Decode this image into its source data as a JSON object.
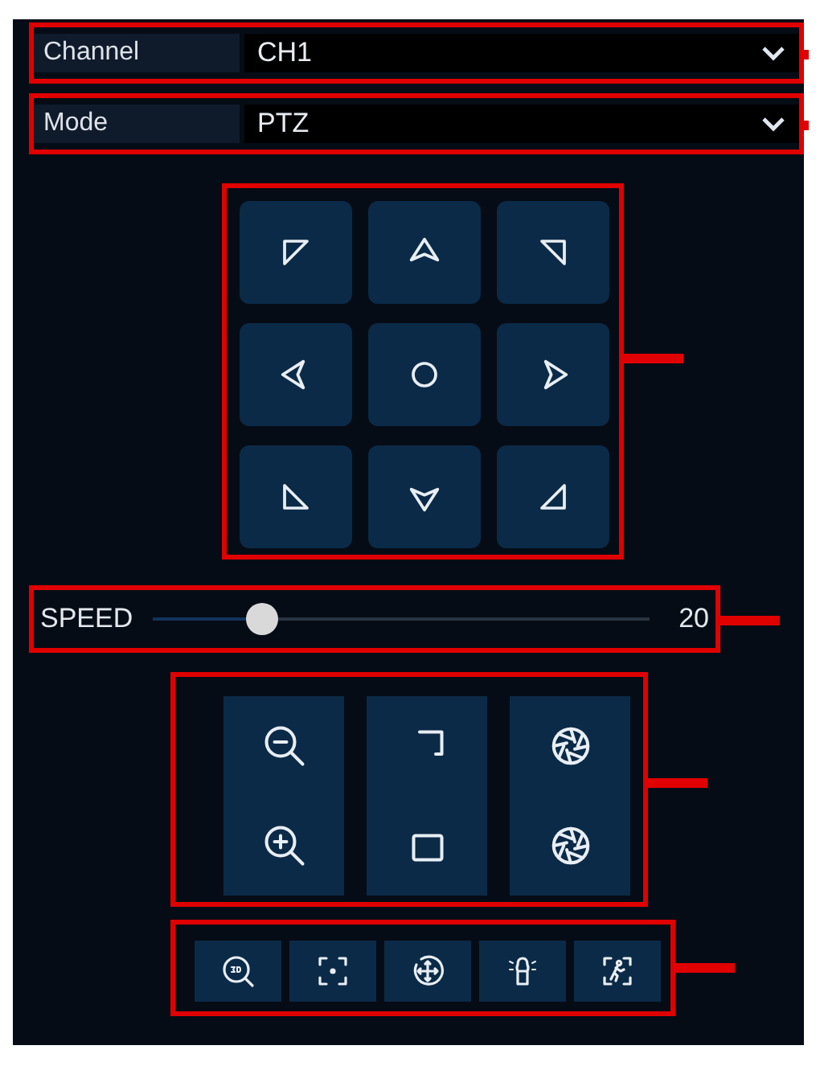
{
  "fields": [
    {
      "label": "Channel",
      "value": "CH1"
    },
    {
      "label": "Mode",
      "value": "PTZ"
    }
  ],
  "speed": {
    "label": "SPEED",
    "value": "20",
    "level": 0.22
  }
}
